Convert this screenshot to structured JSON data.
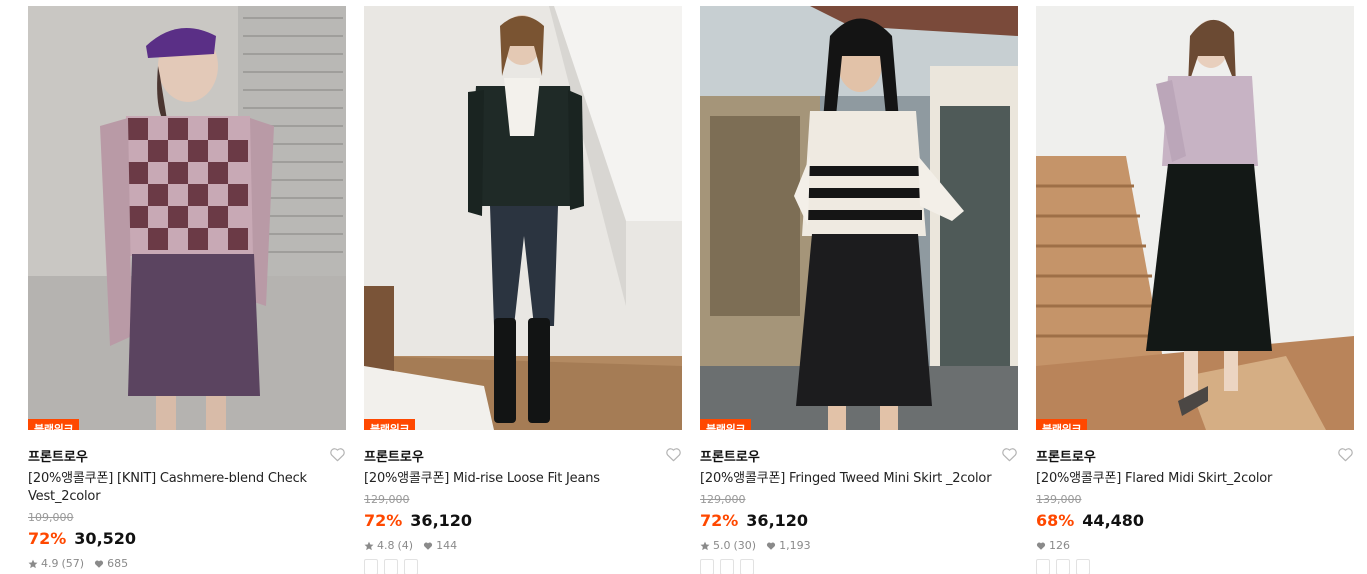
{
  "products": [
    {
      "badge": "블랙위크",
      "brand": "프론트로우",
      "title": "[20%앵콜쿠폰] [KNIT] Cashmere-blend Check Vest_2color",
      "original_price": "109,000",
      "discount": "72%",
      "price": "30,520",
      "rating": "4.9",
      "review_count": "(57)",
      "likes": "685",
      "tags": [
        "",
        "",
        ""
      ]
    },
    {
      "badge": "블랙위크",
      "brand": "프론트로우",
      "title": "[20%앵콜쿠폰] Mid-rise Loose Fit Jeans",
      "original_price": "129,000",
      "discount": "72%",
      "price": "36,120",
      "rating": "4.8",
      "review_count": "(4)",
      "likes": "144",
      "tags": [
        "",
        "",
        ""
      ]
    },
    {
      "badge": "블랙위크",
      "brand": "프론트로우",
      "title": "[20%앵콜쿠폰] Fringed Tweed Mini Skirt _2color",
      "original_price": "129,000",
      "discount": "72%",
      "price": "36,120",
      "rating": "5.0",
      "review_count": "(30)",
      "likes": "1,193",
      "tags": [
        "",
        "",
        ""
      ]
    },
    {
      "badge": "블랙위크",
      "brand": "프론트로우",
      "title": "[20%앵콜쿠폰] Flared Midi Skirt_2color",
      "original_price": "139,000",
      "discount": "68%",
      "price": "44,480",
      "likes": "126",
      "tags": [
        "",
        "",
        ""
      ]
    }
  ],
  "colors": {
    "accent": "#ff4800",
    "strike": "#9a9a9a",
    "meta": "#8a8a8a"
  },
  "icons": {
    "like": "heart-outline-icon",
    "rating": "star-icon",
    "likes_count": "heart-filled-icon"
  }
}
